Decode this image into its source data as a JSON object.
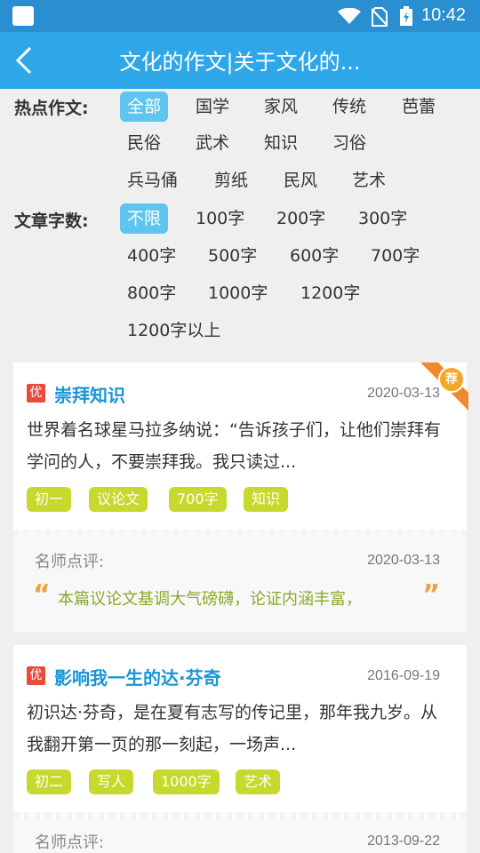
{
  "status_bar": {
    "time": "10:42",
    "icons": [
      "app-icon",
      "wifi-icon",
      "no-sim-icon",
      "battery-icon"
    ]
  },
  "nav": {
    "title": "文化的作文|关于文化的...",
    "back_icon": "chevron-left-icon"
  },
  "filters": {
    "hot_label": "热点作文:",
    "hot_items": [
      "全部",
      "国学",
      "家风",
      "传统",
      "芭蕾",
      "民俗",
      "武术",
      "知识",
      "习俗",
      "兵马俑",
      "剪纸",
      "民风",
      "艺术"
    ],
    "hot_active": "全部",
    "count_label": "文章字数:",
    "count_items": [
      "不限",
      "100字",
      "200字",
      "300字",
      "400字",
      "500字",
      "600字",
      "700字",
      "800字",
      "1000字",
      "1200字",
      "1200字以上"
    ],
    "count_active": "不限"
  },
  "articles": [
    {
      "badge": "优",
      "title": "崇拜知识",
      "date": "2020-03-13",
      "recommend": "荐",
      "excerpt": "世界着名球星马拉多纳说：“告诉孩子们，让他们崇拜有学问的人，不要崇拜我。我只读过...",
      "tags": [
        "初一",
        "议论文",
        "700字",
        "知识"
      ],
      "review_label": "名师点评:",
      "review_date": "2020-03-13",
      "review_text": "本篇议论文基调大气磅礴，论证内涵丰富，"
    },
    {
      "badge": "优",
      "title": "影响我一生的达·芬奇",
      "date": "2016-09-19",
      "excerpt": "初识达·芬奇，是在夏有志写的传记里，那年我九岁。从我翻开第一页的那一刻起，一场声...",
      "tags": [
        "初二",
        "写人",
        "1000字",
        "艺术"
      ],
      "review_label": "名师点评:",
      "review_date": "2013-09-22"
    }
  ],
  "colors": {
    "status_bar": "#2a8fd0",
    "nav_bar": "#2ea7e8",
    "chip_active": "#5ec4f0",
    "tag": "#c6d92c",
    "title": "#1a95d6",
    "badge": "#e84b3c",
    "quote": "#f0a040"
  }
}
